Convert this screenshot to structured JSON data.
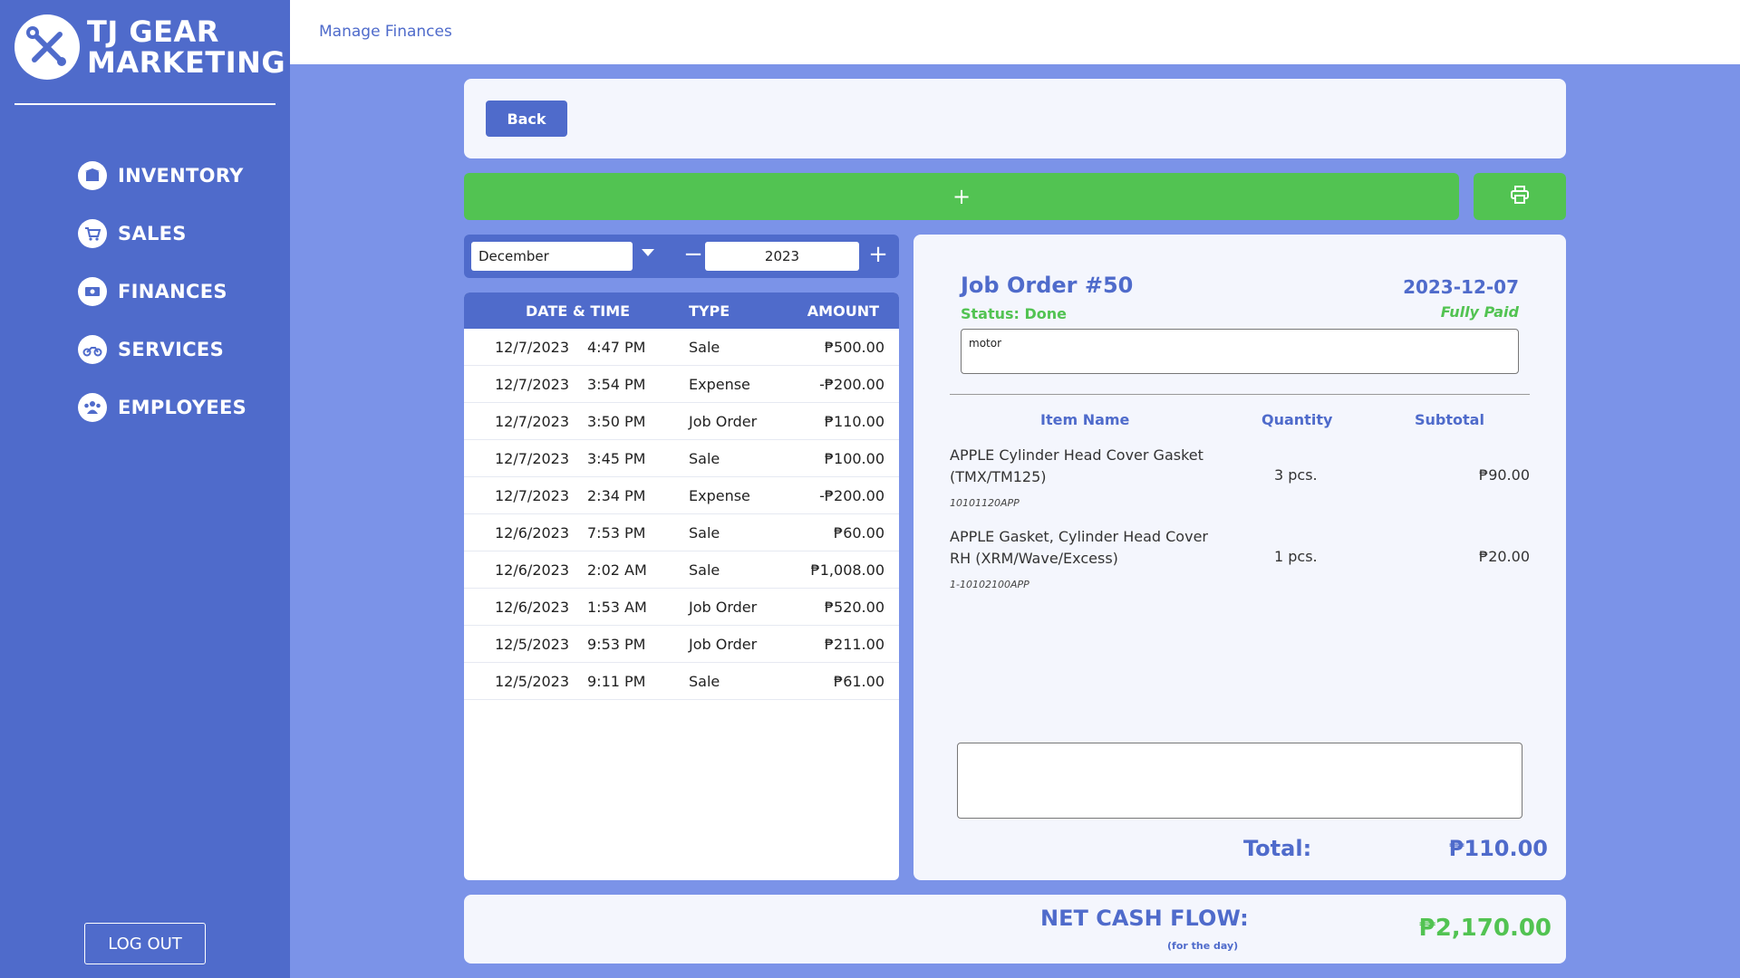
{
  "brand": {
    "line1": "TJ GEAR",
    "line2": "MARKETING"
  },
  "nav": [
    {
      "label": "INVENTORY",
      "icon": "box-icon"
    },
    {
      "label": "SALES",
      "icon": "cart-icon"
    },
    {
      "label": "FINANCES",
      "icon": "money-icon"
    },
    {
      "label": "SERVICES",
      "icon": "motorcycle-icon"
    },
    {
      "label": "EMPLOYEES",
      "icon": "users-icon"
    }
  ],
  "logout_label": "LOG OUT",
  "breadcrumb": "Manage Finances",
  "back_label": "Back",
  "add_label": "+",
  "filter": {
    "month": "December",
    "year": "2023",
    "minus": "−",
    "plus": "+"
  },
  "table": {
    "headers": {
      "datetime": "DATE & TIME",
      "type": "TYPE",
      "amount": "AMOUNT"
    },
    "rows": [
      {
        "date": "12/7/2023",
        "time": "4:47 PM",
        "type": "Sale",
        "amount": "₱500.00"
      },
      {
        "date": "12/7/2023",
        "time": "3:54 PM",
        "type": "Expense",
        "amount": "-₱200.00"
      },
      {
        "date": "12/7/2023",
        "time": "3:50 PM",
        "type": "Job Order",
        "amount": "₱110.00"
      },
      {
        "date": "12/7/2023",
        "time": "3:45 PM",
        "type": "Sale",
        "amount": "₱100.00"
      },
      {
        "date": "12/7/2023",
        "time": "2:34 PM",
        "type": "Expense",
        "amount": "-₱200.00"
      },
      {
        "date": "12/6/2023",
        "time": "7:53 PM",
        "type": "Sale",
        "amount": "₱60.00"
      },
      {
        "date": "12/6/2023",
        "time": "2:02 AM",
        "type": "Sale",
        "amount": "₱1,008.00"
      },
      {
        "date": "12/6/2023",
        "time": "1:53 AM",
        "type": "Job Order",
        "amount": "₱520.00"
      },
      {
        "date": "12/5/2023",
        "time": "9:53 PM",
        "type": "Job Order",
        "amount": "₱211.00"
      },
      {
        "date": "12/5/2023",
        "time": "9:11 PM",
        "type": "Sale",
        "amount": "₱61.00"
      }
    ]
  },
  "job": {
    "title": "Job Order #50",
    "date": "2023-12-07",
    "status": "Status: Done",
    "payment": "Fully Paid",
    "notes": "motor",
    "headers": {
      "name": "Item Name",
      "qty": "Quantity",
      "subtotal": "Subtotal"
    },
    "items": [
      {
        "name": "APPLE Cylinder Head Cover Gasket (TMX/TM125)",
        "code": "10101120APP",
        "qty": "3 pcs.",
        "subtotal": "₱90.00"
      },
      {
        "name": "APPLE Gasket, Cylinder Head Cover RH (XRM/Wave/Excess)",
        "code": "1-10102100APP",
        "qty": "1 pcs.",
        "subtotal": "₱20.00"
      }
    ],
    "total_label": "Total:",
    "total_value": "₱110.00"
  },
  "net_cash_flow": {
    "label": "NET CASH FLOW:",
    "sub": "(for the day)",
    "value": "₱2,170.00"
  },
  "colors": {
    "accent": "#4f6bcb",
    "background": "#7b93e8",
    "success": "#52c352"
  }
}
